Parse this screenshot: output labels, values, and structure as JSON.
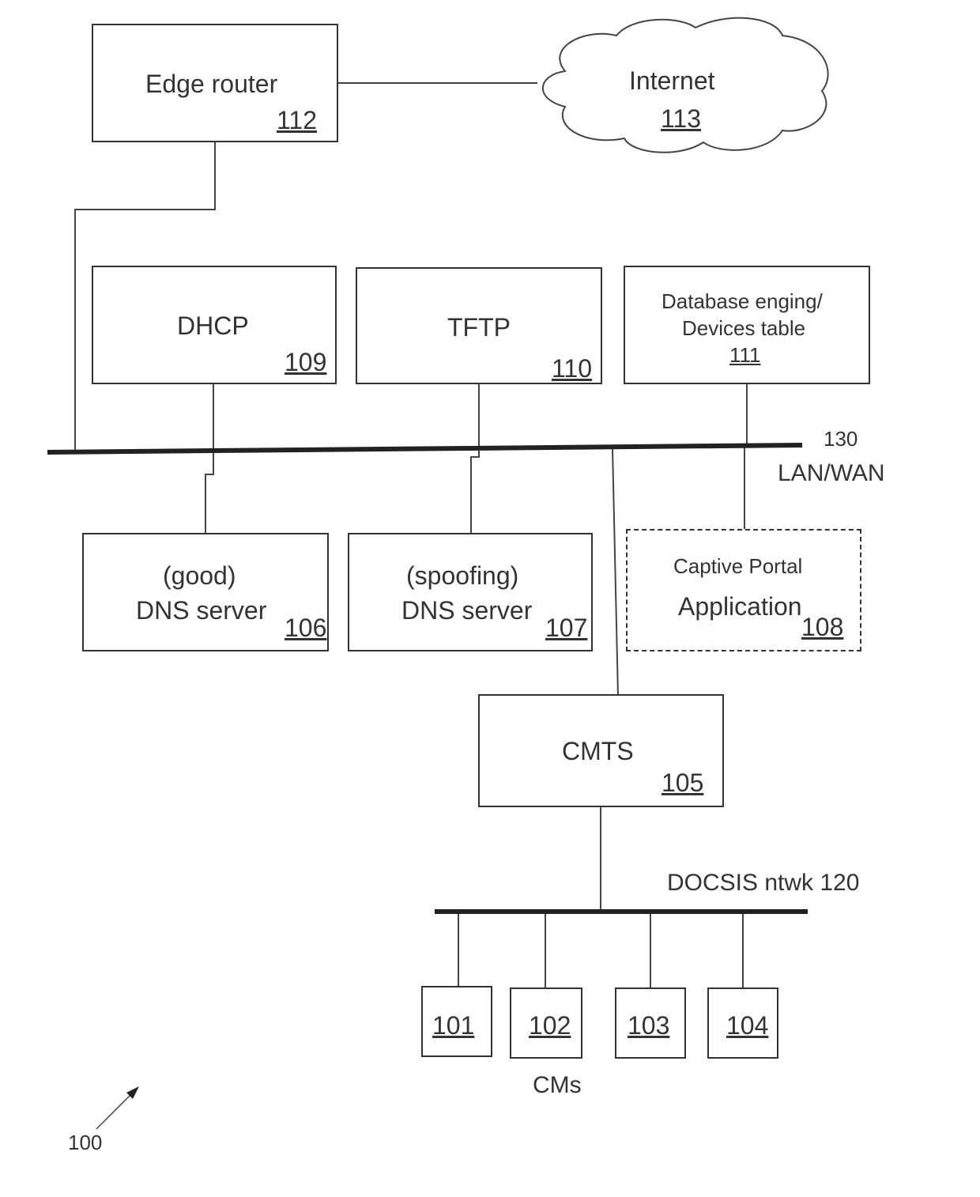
{
  "figure_ref": "100",
  "nodes": {
    "edge_router": {
      "label": "Edge router",
      "ref": "112"
    },
    "internet": {
      "label": "Internet",
      "ref": "113"
    },
    "dhcp": {
      "label": "DHCP",
      "ref": "109"
    },
    "tftp": {
      "label": "TFTP",
      "ref": "110"
    },
    "database": {
      "label_line1": "Database enging/",
      "label_line2": "Devices table",
      "ref": "111"
    },
    "good_dns": {
      "label_line1": "(good)",
      "label_line2": "DNS server",
      "ref": "106"
    },
    "spoof_dns": {
      "label_line1": "(spoofing)",
      "label_line2": "DNS server",
      "ref": "107"
    },
    "captive_portal": {
      "label_line1": "Captive Portal",
      "label_line2": "Application",
      "ref": "108"
    },
    "cmts": {
      "label": "CMTS",
      "ref": "105"
    },
    "cms": [
      {
        "ref": "101"
      },
      {
        "ref": "102"
      },
      {
        "ref": "103"
      },
      {
        "ref": "104"
      }
    ]
  },
  "networks": {
    "lan": {
      "ref": "130",
      "label": "LAN/WAN"
    },
    "docsis": {
      "label": "DOCSIS ntwk 120"
    }
  },
  "cms_label": "CMs"
}
